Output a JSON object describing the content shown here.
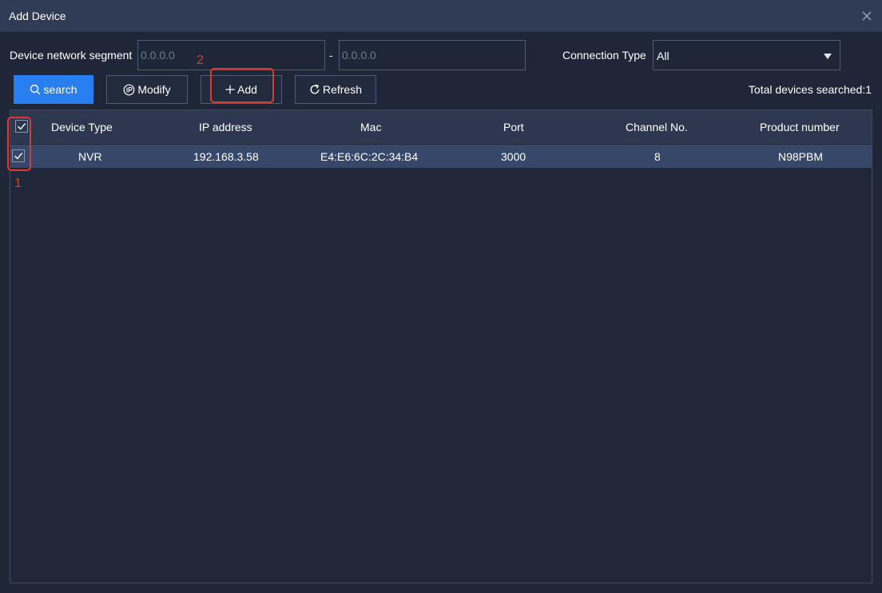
{
  "window": {
    "title": "Add Device"
  },
  "filters": {
    "segment_label": "Device network segment",
    "segment_start_placeholder": "0.0.0.0",
    "segment_end_placeholder": "0.0.0.0",
    "separator": "-",
    "connection_label": "Connection Type",
    "connection_value": "All"
  },
  "toolbar": {
    "search_label": "search",
    "modify_label": "Modify",
    "add_label": "Add",
    "refresh_label": "Refresh",
    "total_text": "Total devices searched:1"
  },
  "table": {
    "columns": [
      "Device Type",
      "IP address",
      "Mac",
      "Port",
      "Channel No.",
      "Product number"
    ],
    "select_all_checked": true,
    "rows": [
      {
        "checked": true,
        "cells": [
          "NVR",
          "192.168.3.58",
          "E4:E6:6C:2C:34:B4",
          "3000",
          "8",
          "N98PBM"
        ]
      }
    ]
  },
  "annotations": {
    "step1": "1",
    "step2": "2",
    "color": "#e0392f"
  },
  "colors": {
    "accent": "#2a7ff0",
    "selected_row": "#37476a",
    "header": "#2d3850"
  }
}
